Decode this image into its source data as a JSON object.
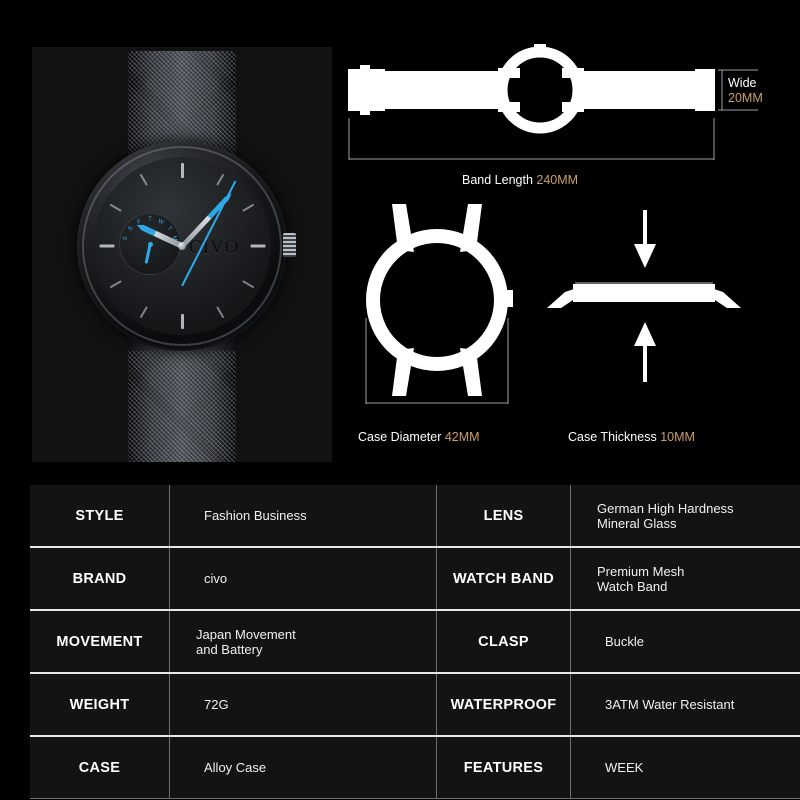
{
  "product": {
    "brand_logo": "CIVO",
    "subdial_weekdays": [
      "S",
      "S",
      "F",
      "T",
      "W",
      "T",
      "M"
    ]
  },
  "diagrams": {
    "band": {
      "length_label": "Band Length",
      "length_value": "240MM",
      "wide_label": "Wide",
      "wide_value": "20MM"
    },
    "case": {
      "diameter_label": "Case Diameter",
      "diameter_value": "42MM"
    },
    "thickness": {
      "thickness_label": "Case Thickness",
      "thickness_value": "10MM"
    }
  },
  "colors": {
    "background": "#000000",
    "accent_gold": "#c9a063",
    "accent_blue": "#2fa8e8",
    "panel": "#121212",
    "table_cell": "#131313",
    "divider": "#e8e8e8"
  },
  "spec_table": {
    "rows": [
      {
        "key_left": "STYLE",
        "val_left_line1": "Fashion Business",
        "val_left_line2": "",
        "key_right": "LENS",
        "val_right_line1": "German High Hardness",
        "val_right_line2": "Mineral Glass"
      },
      {
        "key_left": "BRAND",
        "val_left_line1": "civo",
        "val_left_line2": "",
        "key_right": "WATCH BAND",
        "val_right_line1": "Premium Mesh",
        "val_right_line2": "Watch Band"
      },
      {
        "key_left": "MOVEMENT",
        "val_left_line1": "Japan Movement",
        "val_left_line2": "and Battery",
        "key_right": "CLASP",
        "val_right_line1": "Buckle",
        "val_right_line2": ""
      },
      {
        "key_left": "WEIGHT",
        "val_left_line1": "72G",
        "val_left_line2": "",
        "key_right": "WATERPROOF",
        "val_right_line1": "3ATM Water Resistant",
        "val_right_line2": ""
      },
      {
        "key_left": "CASE",
        "val_left_line1": "Alloy Case",
        "val_left_line2": "",
        "key_right": "FEATURES",
        "val_right_line1": "WEEK",
        "val_right_line2": ""
      }
    ]
  }
}
